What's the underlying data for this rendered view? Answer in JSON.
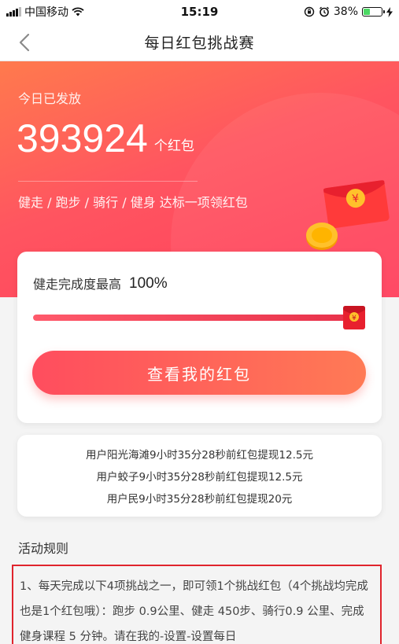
{
  "status_bar": {
    "carrier": "中国移动",
    "time": "15:19",
    "battery_percent": "38%",
    "battery_level": 0.38,
    "icons": [
      "signal-icon",
      "wifi-icon",
      "orientation-lock-icon",
      "alarm-icon",
      "battery-icon",
      "charging-icon"
    ]
  },
  "nav": {
    "title": "每日红包挑战赛",
    "back_icon": "chevron-left-icon"
  },
  "hero": {
    "label": "今日已发放",
    "count": "393924",
    "unit": "个红包",
    "description": "健走 / 跑步 / 骑行 / 健身 达标一项领红包",
    "envelope_symbol": "¥"
  },
  "progress": {
    "label": "健走完成度最高",
    "value_text": "100%",
    "value": 1.0,
    "thumb_symbol": "¥",
    "button_label": "查看我的红包"
  },
  "records": [
    "用户阳光海滩9小时35分28秒前红包提现12.5元",
    "用户蛟子9小时35分28秒前红包提现12.5元",
    "用户民9小时35分28秒前红包提现20元"
  ],
  "rules": {
    "title": "活动规则",
    "text": "1、每天完成以下4项挑战之一，即可领1个挑战红包（4个挑战均完成也是1个红包哦）：跑步 0.9公里、健走 450步、骑行0.9 公里、完成健身课程 5 分钟。请在我的-设置-设置每日"
  },
  "colors": {
    "accent": "#ff4d5e",
    "highlight_border": "#e0242d",
    "envelope": "#ff3a3a",
    "coin": "#ffb400"
  }
}
